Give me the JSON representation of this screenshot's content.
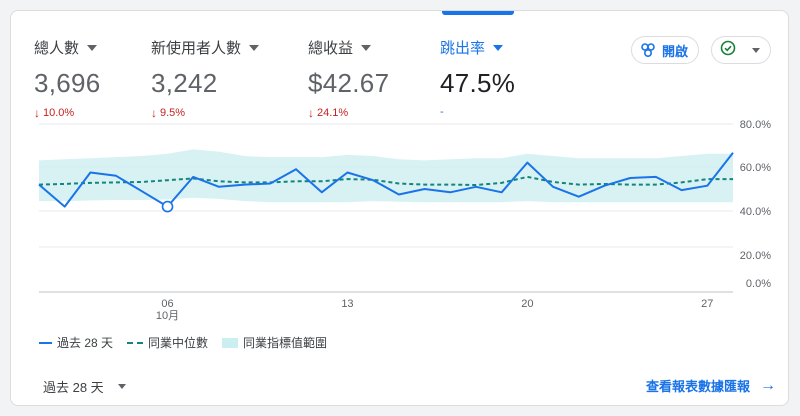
{
  "metrics": [
    {
      "label": "總人數",
      "value": "3,696",
      "change": "10.0%",
      "direction": "down",
      "active": false
    },
    {
      "label": "新使用者人數",
      "value": "3,242",
      "change": "9.5%",
      "direction": "down",
      "active": false
    },
    {
      "label": "總收益",
      "value": "$42.67",
      "change": "24.1%",
      "direction": "down",
      "active": false
    },
    {
      "label": "跳出率",
      "value": "47.5%",
      "change": "-",
      "direction": "none",
      "active": true
    }
  ],
  "actions": {
    "open_label": "開啟",
    "status_icon": "check-circle-icon"
  },
  "legend": {
    "series": "過去 28 天",
    "median": "同業中位數",
    "range": "同業指標值範圍"
  },
  "footer": {
    "range_label": "過去 28 天",
    "report_link": "查看報表數據匯報",
    "report_arrow": "→"
  },
  "colors": {
    "series": "#1a73e8",
    "median": "#12857e",
    "band": "#cbeef0",
    "negative": "#c5221f"
  },
  "chart_data": {
    "type": "line",
    "x_day_ticks": [
      "06",
      "13",
      "20",
      "27"
    ],
    "x_month_label": "10月",
    "y_tick_labels": [
      "80.0%",
      "60.0%",
      "40.0%",
      "20.0%",
      "0.0%"
    ],
    "series": [
      {
        "name": "過去 28 天",
        "values": [
          52.0,
          42.0,
          57.5,
          56.0,
          49.0,
          42.0,
          55.5,
          51.0,
          52.0,
          52.5,
          59.0,
          48.5,
          57.5,
          54.0,
          47.5,
          50.0,
          48.5,
          51.0,
          48.5,
          62.0,
          51.0,
          46.5,
          51.5,
          55.0,
          55.5,
          49.5,
          51.5,
          66.5
        ]
      },
      {
        "name": "同業中位數",
        "values": [
          52.0,
          52.3,
          52.8,
          53.0,
          53.2,
          54.0,
          54.8,
          53.5,
          53.0,
          53.0,
          53.5,
          53.5,
          54.5,
          54.2,
          52.5,
          52.0,
          52.0,
          51.8,
          52.8,
          55.5,
          53.2,
          52.0,
          52.3,
          52.0,
          52.0,
          53.0,
          54.5,
          54.5
        ]
      },
      {
        "name": "同業指標值範圍",
        "upper": [
          63.0,
          63.5,
          64.0,
          64.5,
          65.0,
          66.0,
          68.0,
          67.0,
          65.0,
          64.5,
          64.5,
          64.5,
          65.5,
          65.0,
          63.5,
          63.0,
          63.5,
          64.0,
          64.0,
          66.0,
          65.0,
          64.0,
          64.0,
          64.0,
          64.0,
          65.0,
          66.0,
          66.0
        ],
        "lower": [
          44.5,
          44.5,
          44.8,
          45.0,
          45.0,
          45.3,
          46.0,
          45.5,
          44.5,
          44.0,
          44.0,
          44.0,
          44.0,
          44.5,
          44.2,
          44.0,
          44.0,
          44.0,
          44.0,
          44.5,
          44.0,
          44.0,
          44.0,
          44.0,
          44.0,
          44.0,
          44.0,
          44.0
        ]
      }
    ],
    "highlight_index": 5
  }
}
